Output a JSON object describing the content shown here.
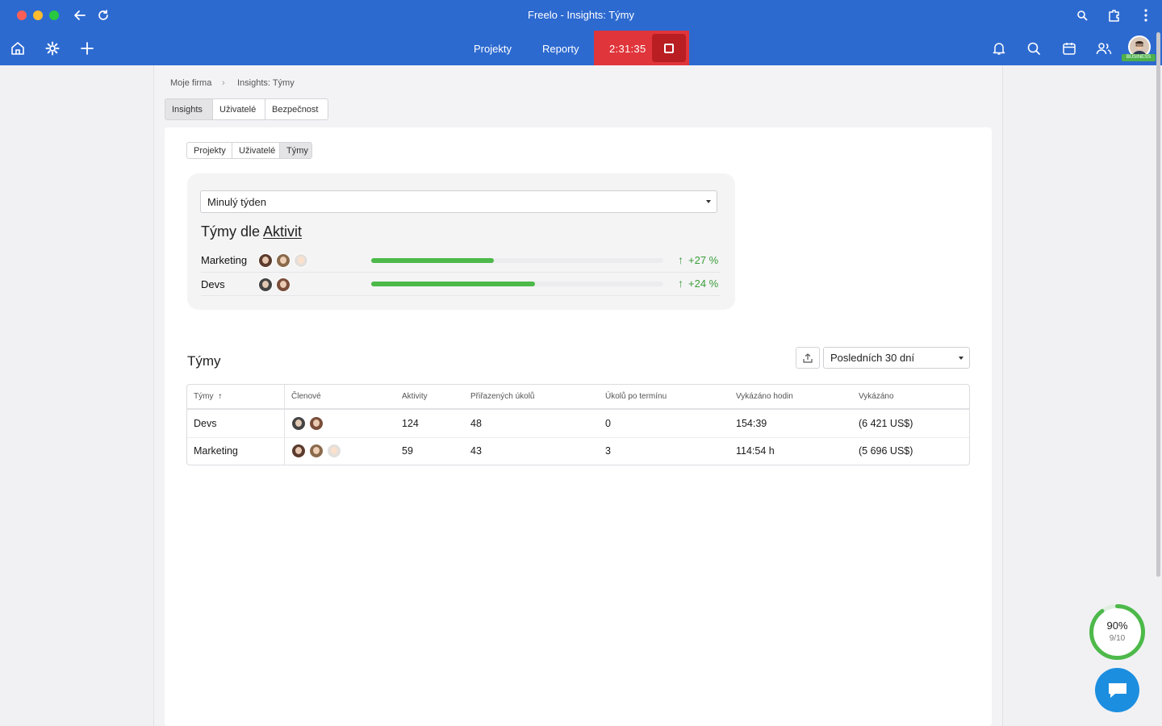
{
  "window": {
    "title": "Freelo - Insights: Týmy"
  },
  "nav": {
    "links": [
      "Projekty",
      "Reporty"
    ],
    "timer": "2:31:35",
    "badge": "BUSINESS"
  },
  "breadcrumb": {
    "root": "Moje firma",
    "current": "Insights: Týmy"
  },
  "tabs_main": [
    "Insights",
    "Uživatelé",
    "Bezpečnost"
  ],
  "tabs_sub": [
    "Projekty",
    "Uživatelé",
    "Týmy"
  ],
  "insights": {
    "period": "Minulý týden",
    "title_prefix": "Týmy dle ",
    "title_link": "Aktivit",
    "rows": [
      {
        "team": "Marketing",
        "progress": 0.42,
        "change": "+27 %"
      },
      {
        "team": "Devs",
        "progress": 0.56,
        "change": "+24 %"
      }
    ]
  },
  "teams": {
    "title": "Týmy",
    "period": "Posledních 30 dní",
    "columns": [
      "Týmy",
      "Členové",
      "Aktivity",
      "Přiřazených úkolů",
      "Úkolů po termínu",
      "Vykázáno hodin",
      "Vykázáno"
    ],
    "sort_arrow": "↑",
    "rows": [
      {
        "team": "Devs",
        "activities": "124",
        "assigned": "48",
        "overdue": "0",
        "hours": "154:39",
        "amount": "(6 421 US$)"
      },
      {
        "team": "Marketing",
        "activities": "59",
        "assigned": "43",
        "overdue": "3",
        "hours": "114:54 h",
        "amount": "(5 696 US$)"
      }
    ]
  },
  "progress_widget": {
    "percent": "90%",
    "fraction": "9/10",
    "value": 0.9
  }
}
